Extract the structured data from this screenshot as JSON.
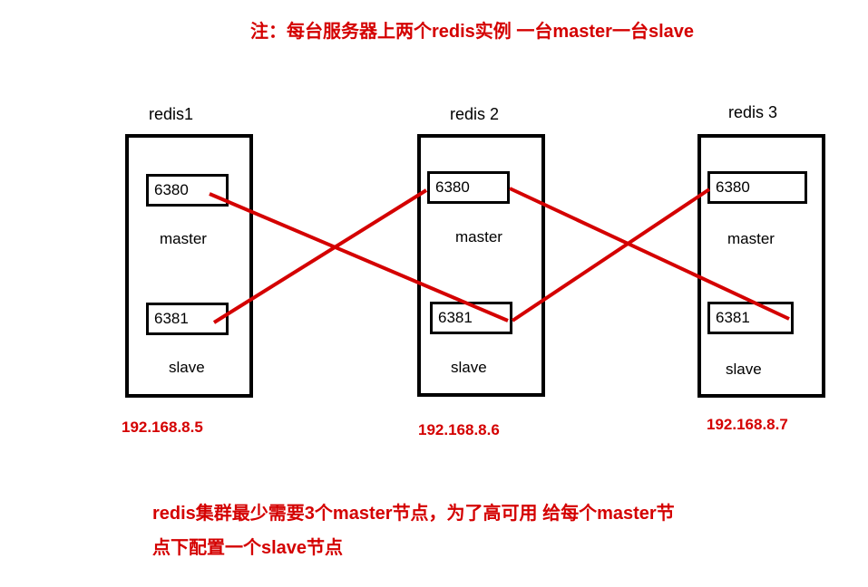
{
  "top_note": "注：每台服务器上两个redis实例 一台master一台slave",
  "servers": [
    {
      "label": "redis1",
      "port_master": "6380",
      "role_master": "master",
      "port_slave": "6381",
      "role_slave": "slave",
      "ip": "192.168.8.5"
    },
    {
      "label": "redis 2",
      "port_master": "6380",
      "role_master": "master",
      "port_slave": "6381",
      "role_slave": "slave",
      "ip": "192.168.8.6"
    },
    {
      "label": "redis 3",
      "port_master": "6380",
      "role_master": "master",
      "port_slave": "6381",
      "role_slave": "slave",
      "ip": "192.168.8.7"
    }
  ],
  "bottom_note_line1": "redis集群最少需要3个master节点，为了高可用 给每个master节",
  "bottom_note_line2": "点下配置一个slave节点",
  "chart_data": {
    "type": "diagram",
    "title": "Redis cluster topology: 3 servers each running one master and one slave instance",
    "nodes": [
      {
        "server": "redis1",
        "ip": "192.168.8.5",
        "master_port": 6380,
        "slave_port": 6381
      },
      {
        "server": "redis 2",
        "ip": "192.168.8.6",
        "master_port": 6380,
        "slave_port": 6381
      },
      {
        "server": "redis 3",
        "ip": "192.168.8.7",
        "master_port": 6380,
        "slave_port": 6381
      }
    ],
    "replication_links": [
      {
        "master": "192.168.8.5:6380",
        "slave": "192.168.8.6:6381"
      },
      {
        "master": "192.168.8.6:6380",
        "slave": "192.168.8.5:6381"
      },
      {
        "master": "192.168.8.6:6380",
        "slave": "192.168.8.7:6381"
      },
      {
        "master": "192.168.8.7:6380",
        "slave": "192.168.8.6:6381"
      }
    ],
    "notes": [
      "每台服务器上两个redis实例 一台master一台slave",
      "redis集群最少需要3个master节点，为了高可用 给每个master节点下配置一个slave节点"
    ]
  }
}
